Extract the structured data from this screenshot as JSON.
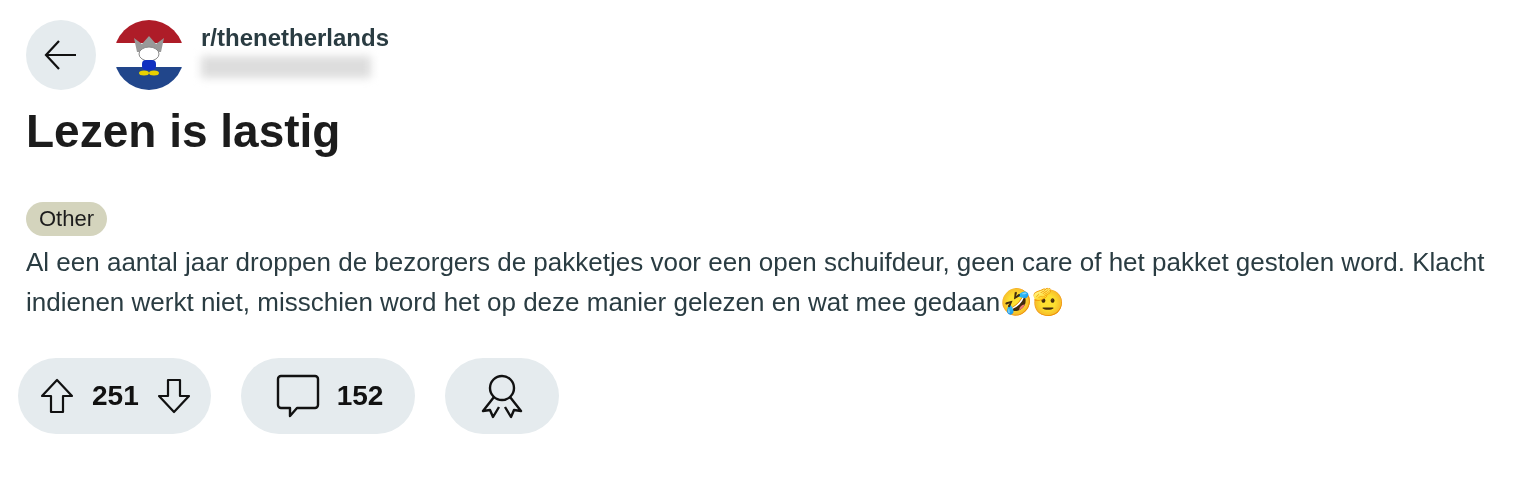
{
  "community": {
    "name": "r/thenetherlands"
  },
  "post": {
    "title": "Lezen is lastig",
    "flair": {
      "label": "Other",
      "color": "#d4d4bd"
    },
    "body": "Al een aantal jaar droppen de bezorgers de pakketjes voor een open schuifdeur, geen care of het pakket gestolen word. Klacht indienen werkt niet, misschien word het op deze manier gelezen en wat mee gedaan🤣🫡"
  },
  "actions": [
    {
      "kind": "vote",
      "count": "251"
    },
    {
      "kind": "comments",
      "count": "152"
    },
    {
      "kind": "award"
    }
  ]
}
